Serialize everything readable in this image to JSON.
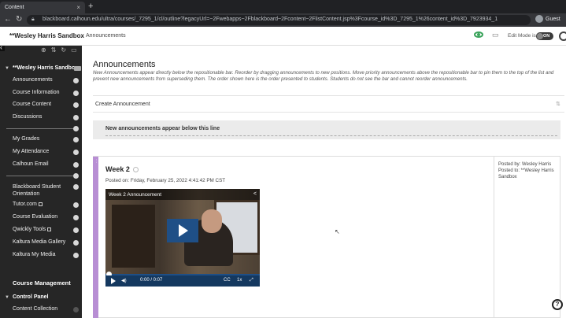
{
  "browser": {
    "tab_title": "Content",
    "tab_close": "×",
    "new_tab": "+",
    "url": "blackboard.calhoun.edu/ultra/courses/_7295_1/cl/outline?legacyUrl=~2Fwebapps~2Fblackboard~2Fcontent~2FlistContent.jsp%3Fcourse_id%3D_7295_1%26content_id%3D_7923934_1",
    "profile": "Guest"
  },
  "header": {
    "course_name": "**Wesley Harris Sandbox",
    "breadcrumb": "Announcements",
    "edit_mode_label": "Edit Mode is:",
    "edit_mode_state": "ON"
  },
  "sidebar": {
    "course_title": "**Wesley Harris Sandbox",
    "items_group1": [
      "Announcements",
      "Course Information",
      "Course Content",
      "Discussions"
    ],
    "items_group2": [
      "My Grades",
      "My Attendance",
      "Calhoun Email"
    ],
    "items_group3": [
      "Blackboard Student Orientation",
      "Tutor.com",
      "Course Evaluation",
      "Qwickly Tools",
      "Kaltura Media Gallery",
      "Kaltura My Media"
    ],
    "course_management": "Course Management",
    "control_panel": "Control Panel",
    "content_collection": "Content Collection"
  },
  "main": {
    "title": "Announcements",
    "instructions": "New Announcements appear directly below the repositionable bar. Reorder by dragging announcements to new positions. Move priority announcements above the repositionable bar to pin them to the top of the list and prevent new announcements from superseding them. The order shown here is the order presented to students. Students do not see the bar and cannot reorder announcements.",
    "create_button": "Create Announcement",
    "reposition_bar": "New announcements appear below this line"
  },
  "announcement": {
    "title": "Week 2",
    "posted_on": "Posted on: Friday, February 25, 2022 4:41:42 PM CST",
    "posted_by": "Posted by: Wesley Harris",
    "posted_to": "Posted to: **Wesley Harris Sandbox"
  },
  "video": {
    "title": "Week 2 Announcement",
    "time": "0:00 / 0:07",
    "speed": "1x",
    "progress": 0.0
  },
  "colors": {
    "accent_purple": "#b88ed4",
    "video_blue": "#1f4f86",
    "toggle_dark": "#3b3b3b",
    "visibility_green": "#3aa35b"
  }
}
